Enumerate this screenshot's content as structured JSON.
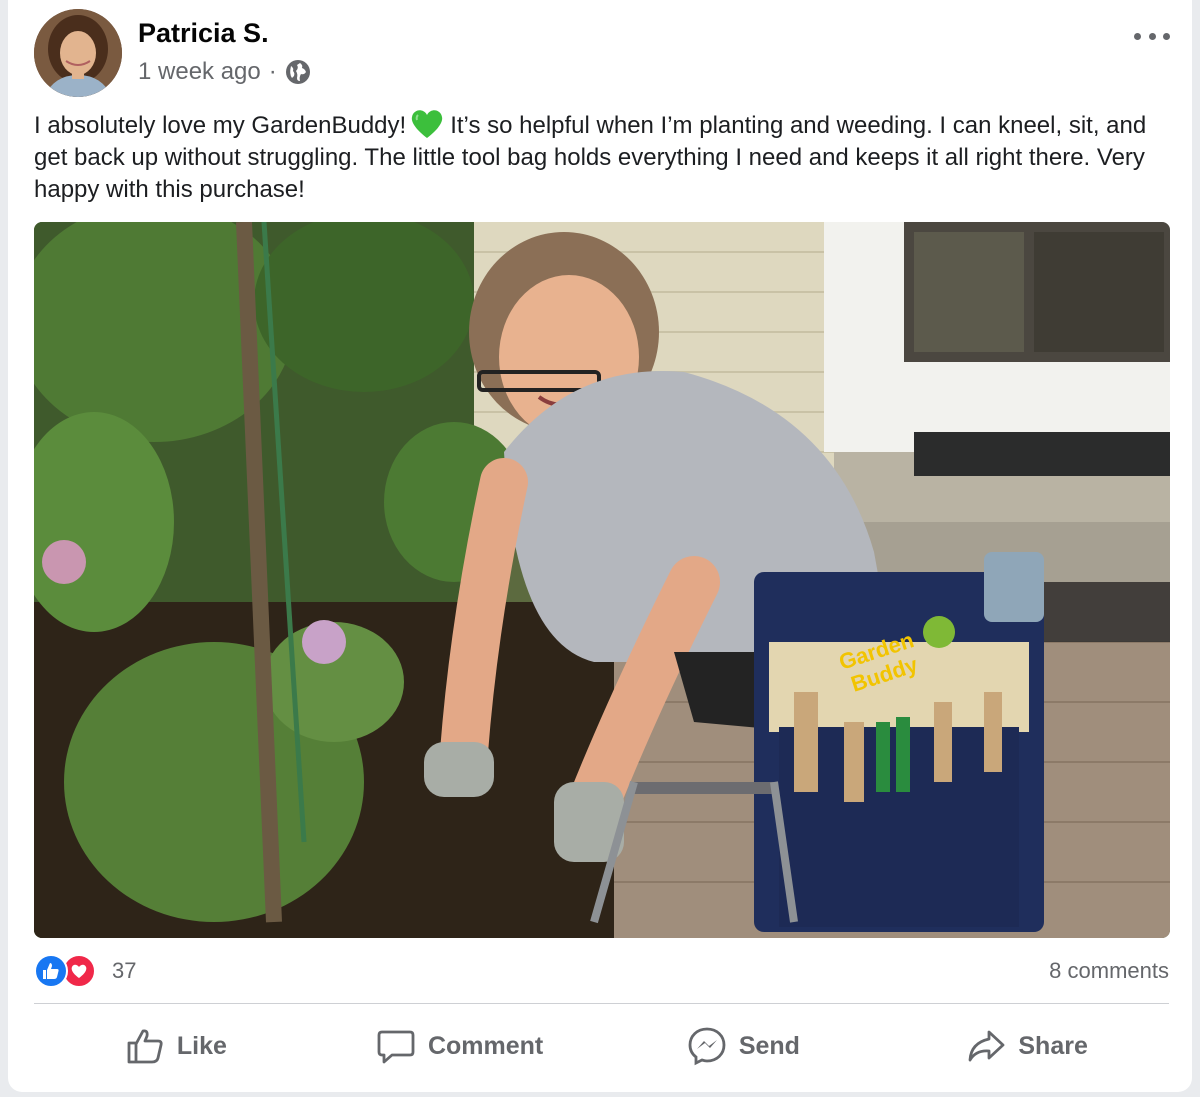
{
  "post": {
    "author": "Patricia S.",
    "time": "1 week ago",
    "separator": "·",
    "audience_icon": "globe-icon",
    "text_part1": "I absolutely love my GardenBuddy!",
    "emoji": "green-heart",
    "text_part2": "It’s so helpful when I’m planting and weeding. I can kneel, sit, and get back up without struggling. The little tool bag holds everything I need and keeps it all right there. Very happy with this purchase!",
    "photo_brand_line1": "Garden",
    "photo_brand_line2": "Buddy"
  },
  "stats": {
    "reactions_count": "37",
    "comments": "8 comments"
  },
  "actions": {
    "like": "Like",
    "comment": "Comment",
    "send": "Send",
    "share": "Share"
  },
  "colors": {
    "like_blue": "#1877f2",
    "love_red": "#f02849",
    "secondary_text": "#65676b"
  }
}
